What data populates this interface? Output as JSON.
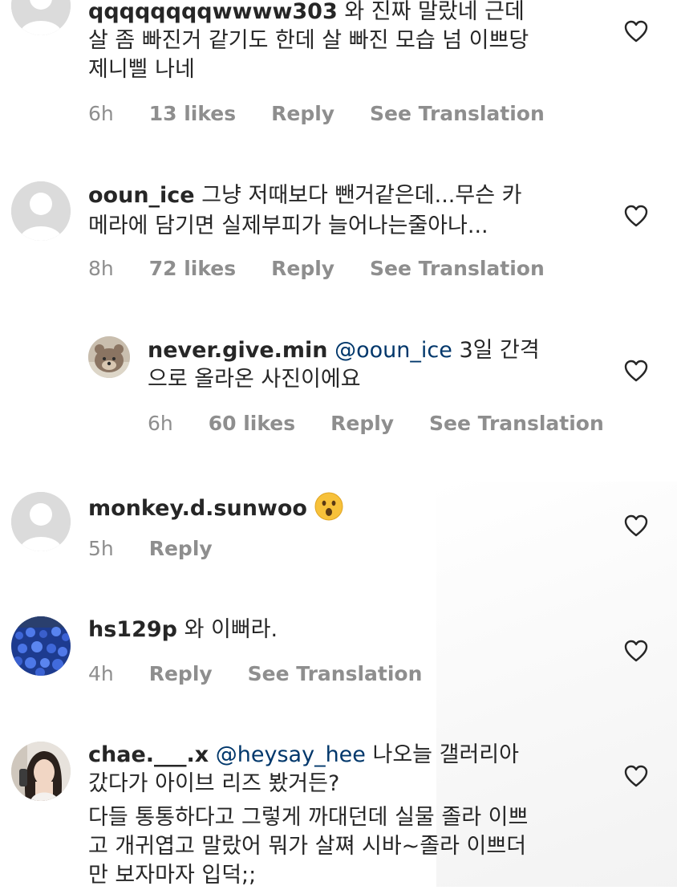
{
  "comments": [
    {
      "username": "qqqqqqqqwwww303",
      "body_line1": "와 진짜 말랐네 근데",
      "body_line2": "살 좀 빠진거 같기도 한데 살 빠진 모습 넘 이쁘당",
      "body_line3": "제니삘 나네",
      "time": "6h",
      "likes": "13 likes",
      "reply": "Reply",
      "translate": "See Translation",
      "avatar": "default-avatar-icon"
    },
    {
      "username": "ooun_ice",
      "body_line1": "그냥 저때보다 뺀거같은데...무슨 카",
      "body_line2": "메라에 담기면 실제부피가 늘어나는줄아나...",
      "time": "8h",
      "likes": "72 likes",
      "reply": "Reply",
      "translate": "See Translation",
      "avatar": "default-avatar-icon"
    },
    {
      "username": "never.give.min",
      "mention": "@ooun_ice",
      "body_line1": "3일 간격",
      "body_line2": "으로 올라온 사진이에요",
      "time": "6h",
      "likes": "60 likes",
      "reply": "Reply",
      "translate": "See Translation",
      "avatar": "bear-avatar"
    },
    {
      "username": "monkey.d.sunwoo",
      "emoji": "surprised-face-emoji",
      "time": "5h",
      "reply": "Reply",
      "avatar": "default-avatar-icon"
    },
    {
      "username": "hs129p",
      "body_line1": "와 이뻐라.",
      "time": "4h",
      "reply": "Reply",
      "translate": "See Translation",
      "avatar": "blue-flowers-avatar"
    },
    {
      "username": "chae.___.x",
      "mention": "@heysay_hee",
      "body_line1": " 나오늘 갤러리아",
      "body_line2": "갔다가 아이브 리즈 봤거든?",
      "body_line3": "다들 통통하다고 그렇게 까대던데 실물 졸라 이쁘",
      "body_line4": "고 개귀엽고 말랐어 뭐가 살쪄 시바~졸라 이쁘더",
      "body_line5": "만 보자마자 입덕;;",
      "avatar": "selfie-avatar"
    }
  ]
}
